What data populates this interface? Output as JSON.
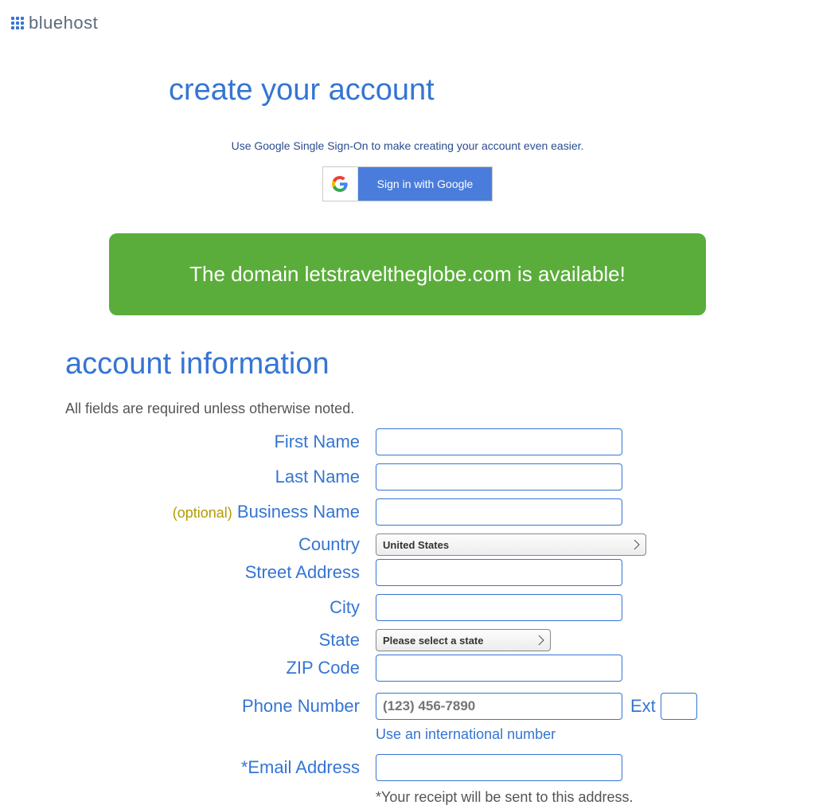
{
  "brand": "bluehost",
  "page_title": "create your account",
  "sso_prompt": "Use Google Single Sign-On to make creating your account even easier.",
  "google_button_label": "Sign in with Google",
  "domain_banner": "The domain letstraveltheglobe.com is available!",
  "section": {
    "title": "account information",
    "note": "All fields are required unless otherwise noted."
  },
  "form": {
    "first_name": {
      "label": "First Name",
      "value": ""
    },
    "last_name": {
      "label": "Last Name",
      "value": ""
    },
    "business_name": {
      "optional": "(optional)",
      "label": "Business Name",
      "value": ""
    },
    "country": {
      "label": "Country",
      "selected": "United States"
    },
    "street_address": {
      "label": "Street Address",
      "value": ""
    },
    "city": {
      "label": "City",
      "value": ""
    },
    "state": {
      "label": "State",
      "selected": "Please select a state"
    },
    "zip": {
      "label": "ZIP Code",
      "value": ""
    },
    "phone": {
      "label": "Phone Number",
      "placeholder": "(123) 456-7890",
      "ext_label": "Ext",
      "ext_value": ""
    },
    "intl_link": "Use an international number",
    "email": {
      "label": "*Email Address",
      "value": ""
    },
    "receipt_note": "*Your receipt will be sent to this address."
  },
  "colors": {
    "brand_blue": "#3575d3",
    "banner_green": "#5aad3a",
    "optional_gold": "#b59a00"
  }
}
